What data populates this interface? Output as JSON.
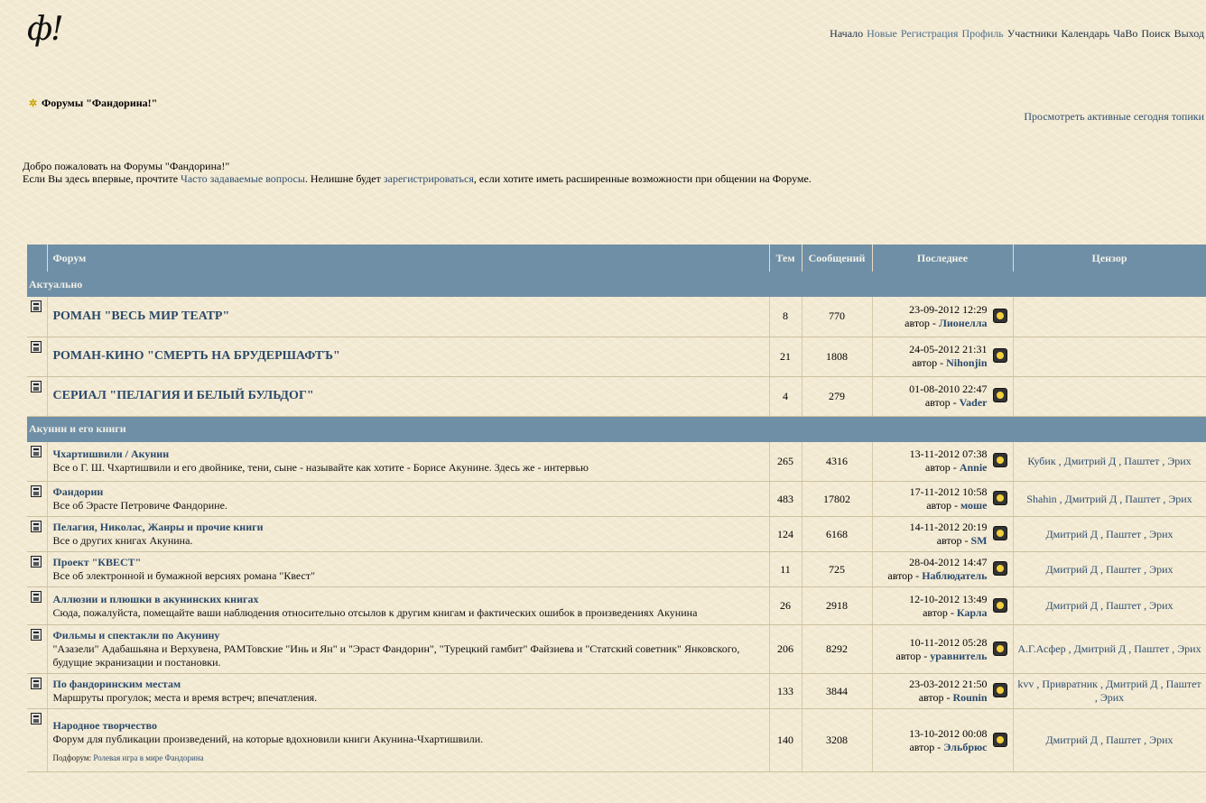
{
  "logo": "ф!",
  "topnav": [
    {
      "label": "Начало",
      "tone": "dark"
    },
    {
      "label": "Новые",
      "tone": "link"
    },
    {
      "label": "Регистрация",
      "tone": "link"
    },
    {
      "label": "Профиль",
      "tone": "link"
    },
    {
      "label": "Участники",
      "tone": "dark"
    },
    {
      "label": "Календарь",
      "tone": "dark"
    },
    {
      "label": "ЧаВо",
      "tone": "dark"
    },
    {
      "label": "Поиск",
      "tone": "dark"
    },
    {
      "label": "Выход",
      "tone": "dark"
    }
  ],
  "breadcrumb": "Форумы \"Фандорина!\"",
  "active_topics_link": "Просмотреть активные сегодня топики",
  "welcome": {
    "line1": "Добро пожаловать на Форумы \"Фандорина!\"",
    "line2_a": "Если Вы здесь впервые, прочтите ",
    "faq_link": "Часто задаваемые вопросы",
    "line2_b": ". Нелишне будет ",
    "register_link": "зарегистрироваться",
    "line2_c": ", если хотите иметь расширенные возможности при общении на Форуме."
  },
  "table": {
    "headers": {
      "forum": "Форум",
      "topics": "Тем",
      "posts": "Сообщений",
      "last": "Последнее",
      "mods": "Цензор"
    },
    "categories": [
      {
        "title": "Актуально",
        "forums": [
          {
            "name": "РОМАН \"ВЕСЬ МИР ТЕАТР\"",
            "desc": "",
            "topics": "8",
            "posts": "770",
            "date": "23-09-2012 12:29",
            "author_prefix": "автор - ",
            "author": "Лионелла",
            "mods": ""
          },
          {
            "name": "РОМАН-КИНО \"СМЕРТЬ НА БРУДЕРШАФТЪ\"",
            "desc": "",
            "topics": "21",
            "posts": "1808",
            "date": "24-05-2012 21:31",
            "author_prefix": "автор - ",
            "author": "Nihonjin",
            "mods": ""
          },
          {
            "name": "СЕРИАЛ \"ПЕЛАГИЯ И БЕЛЫЙ БУЛЬДОГ\"",
            "desc": "",
            "topics": "4",
            "posts": "279",
            "date": "01-08-2010 22:47",
            "author_prefix": "автор - ",
            "author": "Vader",
            "mods": ""
          }
        ]
      },
      {
        "title": "Акунин и его книги",
        "forums": [
          {
            "name": "Чхартишвили / Акунин",
            "desc": "Все о Г. Ш. Чхартишвили и его двойнике, тени, сыне - называйте как хотите - Борисе Акунине. Здесь же - интервью",
            "topics": "265",
            "posts": "4316",
            "date": "13-11-2012 07:38",
            "author_prefix": "автор - ",
            "author": "Annie",
            "mods": "Кубик , Дмитрий Д , Паштет , Эрих"
          },
          {
            "name": "Фандорин",
            "desc": "Все об Эрасте Петровиче Фандорине.",
            "topics": "483",
            "posts": "17802",
            "date": "17-11-2012 10:58",
            "author_prefix": "автор - ",
            "author": "моше",
            "mods": "Shahin , Дмитрий Д , Паштет , Эрих"
          },
          {
            "name": "Пелагия, Николас, Жанры и прочие книги",
            "desc": "Все о других книгах Акунина.",
            "topics": "124",
            "posts": "6168",
            "date": "14-11-2012 20:19",
            "author_prefix": "автор - ",
            "author": "SM",
            "mods": "Дмитрий Д , Паштет , Эрих"
          },
          {
            "name": "Проект \"КВЕСТ\"",
            "desc": "Все об электронной и бумажной версиях романа \"Квест\"",
            "topics": "11",
            "posts": "725",
            "date": "28-04-2012 14:47",
            "author_prefix": "автор - ",
            "author": "Наблюдатель",
            "mods": "Дмитрий Д , Паштет , Эрих"
          },
          {
            "name": "Аллюзии и плюшки в акунинских книгах",
            "desc": "Сюда, пожалуйста, помещайте ваши наблюдения относительно отсылов к другим книгам и фактических ошибок в произведениях Акунина",
            "topics": "26",
            "posts": "2918",
            "date": "12-10-2012 13:49",
            "author_prefix": "автор - ",
            "author": "Карла",
            "mods": "Дмитрий Д , Паштет , Эрих"
          },
          {
            "name": "Фильмы и спектакли по Акунину",
            "desc": "\"Азазели\" Адабашьяна и Верхувена, РАМТовские \"Инь и Ян\" и \"Эраст Фандорин\", \"Турецкий гамбит\" Файзиева и \"Статский советник\" Янковского, будущие экранизации и постановки.",
            "topics": "206",
            "posts": "8292",
            "date": "10-11-2012 05:28",
            "author_prefix": "автор - ",
            "author": "уравнитель",
            "mods": "А.Г.Асфер , Дмитрий Д , Паштет , Эрих"
          },
          {
            "name": "По фандоринским местам",
            "desc": "Маршруты прогулок; места и время встреч; впечатления.",
            "topics": "133",
            "posts": "3844",
            "date": "23-03-2012 21:50",
            "author_prefix": "автор - ",
            "author": "Rounin",
            "mods": "kvv , Привратник , Дмитрий Д , Паштет , Эрих"
          },
          {
            "name": "Народное творчество",
            "desc": "Форум для публикации произведений, на которые вдохновили книги Акунина-Чхартишвили.",
            "subforum_label": "Подфорум: ",
            "subforum": "Ролевая игра в мире Фандорина",
            "topics": "140",
            "posts": "3208",
            "date": "13-10-2012 00:08",
            "author_prefix": "автор - ",
            "author": "Эльбрюс",
            "mods": "Дмитрий Д , Паштет , Эрих"
          }
        ]
      }
    ]
  }
}
